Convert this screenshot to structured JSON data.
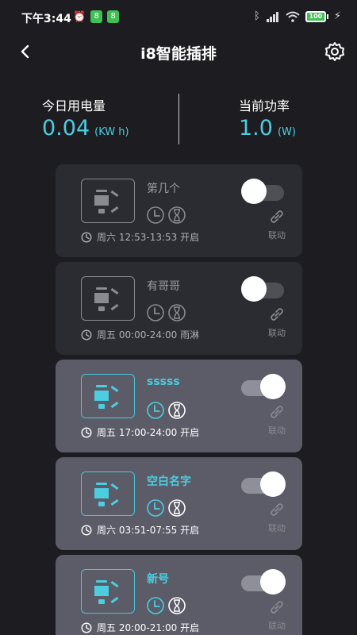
{
  "status_bar": {
    "time": "下午3:44",
    "battery": "100"
  },
  "header": {
    "title": "i8智能插排"
  },
  "stats": {
    "today_label": "今日用电量",
    "today_value": "0.04",
    "today_unit": "(KW h)",
    "power_label": "当前功率",
    "power_value": "1.0",
    "power_unit": "(W)"
  },
  "sockets": [
    {
      "name": "第几个",
      "schedule": "周六 12:53-13:53 开启",
      "switch": "off",
      "link_label": "联动"
    },
    {
      "name": "有哥哥",
      "schedule": "周五 00:00-24:00 雨淋",
      "switch": "off",
      "link_label": "联动"
    },
    {
      "name": "sssss",
      "schedule": "周五 17:00-24:00 开启",
      "switch": "on",
      "link_label": "联动"
    },
    {
      "name": "空白名字",
      "schedule": "周六 03:51-07:55 开启",
      "switch": "on",
      "link_label": "联动"
    },
    {
      "name": "新号",
      "schedule": "周五 20:00-21:00 开启",
      "switch": "on",
      "link_label": "联动"
    }
  ],
  "colors": {
    "accent": "#4ccde0",
    "background": "#1d1d21",
    "card_off": "#2b2c31",
    "card_on": "#5b5c68"
  }
}
